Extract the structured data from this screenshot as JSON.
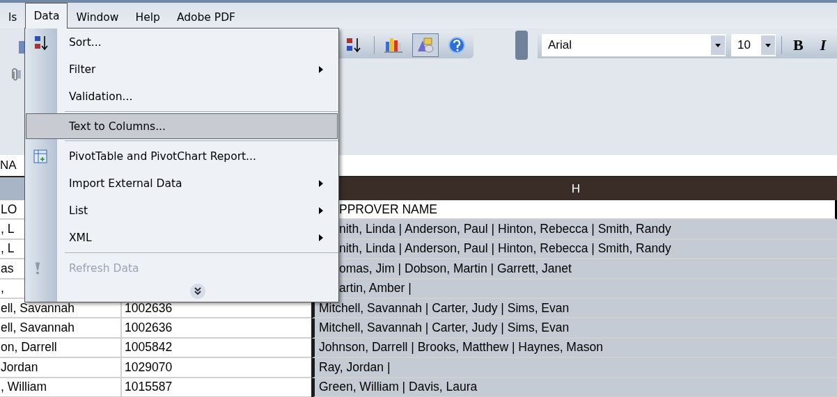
{
  "menubar": [
    {
      "label": "ls",
      "selected": false
    },
    {
      "label": "Data",
      "selected": true
    },
    {
      "label": "Window",
      "selected": false
    },
    {
      "label": "Help",
      "selected": false
    },
    {
      "label": "Adobe PDF",
      "selected": false
    }
  ],
  "toolbar": {
    "buttons": [
      {
        "kind": "sort-desc",
        "pressed": false
      },
      {
        "kind": "chart",
        "pressed": false
      },
      {
        "kind": "drawing",
        "pressed": true
      },
      {
        "kind": "help",
        "pressed": false
      }
    ],
    "font": "Arial",
    "size": "10",
    "bold": "B",
    "italic": "I"
  },
  "name_box": "NA",
  "sheet": {
    "column_header": "H",
    "rows": [
      {
        "col_a": "LO",
        "col_h": "PPROVER NAME"
      },
      {
        "col_a": ", L",
        "col_h": "nith, Linda | Anderson, Paul | Hinton, Rebecca | Smith, Randy"
      },
      {
        "col_a": ", L",
        "col_h": "nith, Linda | Anderson, Paul | Hinton, Rebecca | Smith, Randy"
      },
      {
        "col_a": "as",
        "col_h": "omas, Jim | Dobson, Martin | Garrett, Janet"
      },
      {
        "col_a": ",",
        "col_h": "artin, Amber |"
      },
      {
        "col_a": "ell, Savannah",
        "col_b": "1002636",
        "col_h": "Mitchell, Savannah | Carter, Judy | Sims, Evan"
      },
      {
        "col_a": "ell, Savannah",
        "col_b": "1002636",
        "col_h": "Mitchell, Savannah | Carter, Judy | Sims, Evan"
      },
      {
        "col_a": "on, Darrell",
        "col_b": "1005842",
        "col_h": "Johnson, Darrell | Brooks, Matthew | Haynes, Mason"
      },
      {
        "col_a": "Jordan",
        "col_b": "1029070",
        "col_h": "Ray, Jordan |"
      },
      {
        "col_a": ", William",
        "col_b": "1015587",
        "col_h": "Green, William | Davis, Laura"
      }
    ]
  },
  "menu": {
    "items": [
      {
        "label": "Sort...",
        "selected": false,
        "disabled": false,
        "submenu": false,
        "separator_before": false
      },
      {
        "label": "Filter",
        "selected": false,
        "disabled": false,
        "submenu": true,
        "separator_before": false
      },
      {
        "label": "Validation...",
        "selected": false,
        "disabled": false,
        "submenu": false,
        "separator_before": false
      },
      {
        "label": "Text to Columns...",
        "selected": true,
        "disabled": false,
        "submenu": false,
        "separator_before": true
      },
      {
        "label": "PivotTable and PivotChart Report...",
        "selected": false,
        "disabled": false,
        "submenu": false,
        "separator_before": true
      },
      {
        "label": "Import External Data",
        "selected": false,
        "disabled": false,
        "submenu": true,
        "separator_before": false
      },
      {
        "label": "List",
        "selected": false,
        "disabled": false,
        "submenu": true,
        "separator_before": false
      },
      {
        "label": "XML",
        "selected": false,
        "disabled": false,
        "submenu": true,
        "separator_before": false
      },
      {
        "label": "Refresh Data",
        "selected": false,
        "disabled": true,
        "submenu": false,
        "separator_before": true
      }
    ]
  }
}
